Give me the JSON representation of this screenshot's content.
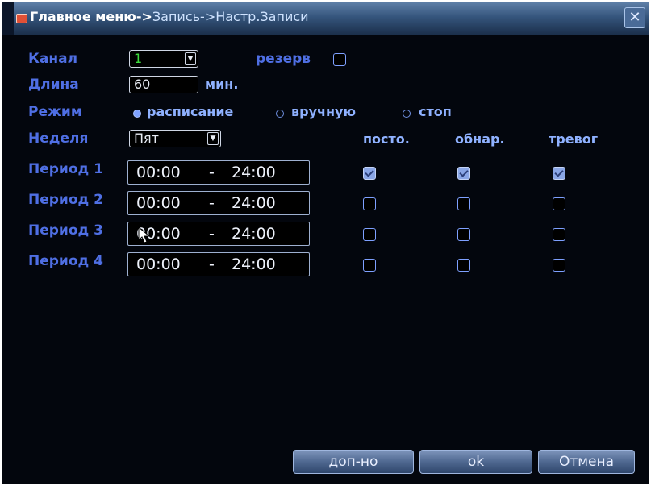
{
  "window": {
    "title_main": "Главное меню->",
    "title_path": "Запись->Настр.Записи",
    "close_glyph": "✕"
  },
  "form": {
    "channel_label": "Канал",
    "channel_value": "1",
    "reserve_label": "резерв",
    "reserve_checked": false,
    "length_label": "Длина",
    "length_value": "60",
    "length_unit": "мин.",
    "mode_label": "Режим",
    "mode_options": [
      "расписание",
      "вручную",
      "стоп"
    ],
    "mode_selected": "расписание",
    "week_label": "Неделя",
    "week_value": "Пят",
    "columns": [
      "посто.",
      "обнар.",
      "тревог"
    ]
  },
  "periods": [
    {
      "label": "Период 1",
      "start": "00:00",
      "sep": "-",
      "end": "24:00",
      "checks": [
        true,
        true,
        true
      ]
    },
    {
      "label": "Период 2",
      "start": "00:00",
      "sep": "-",
      "end": "24:00",
      "checks": [
        false,
        false,
        false
      ]
    },
    {
      "label": "Период 3",
      "start": "00:00",
      "sep": "-",
      "end": "24:00",
      "checks": [
        false,
        false,
        false
      ]
    },
    {
      "label": "Период 4",
      "start": "00:00",
      "sep": "-",
      "end": "24:00",
      "checks": [
        false,
        false,
        false
      ]
    }
  ],
  "buttons": {
    "advanced": "доп-но",
    "ok": "ok",
    "cancel": "Отмена"
  },
  "colors": {
    "label_blue": "#4f6fe4",
    "channel_value": "#3ddc3d"
  }
}
